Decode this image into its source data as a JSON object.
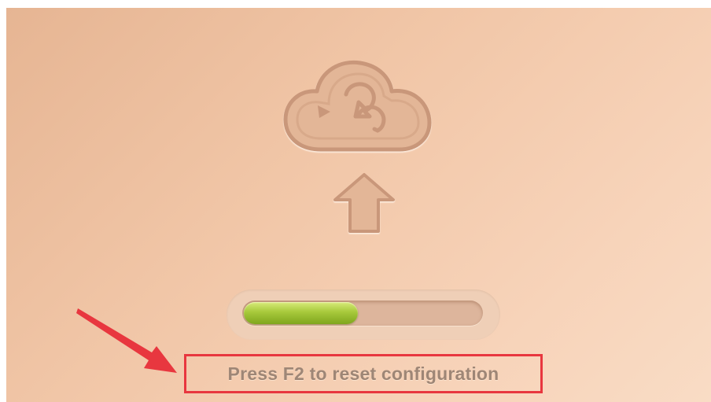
{
  "screen": {
    "icon": "cloud-upload-icon",
    "progress": {
      "fraction": 0.48,
      "fill_color": "#a7c93b"
    },
    "hint": {
      "text": "Press F2 to reset configuration",
      "box_color": "#e8373f"
    },
    "annotation": {
      "icon": "red-arrow-icon",
      "color": "#e8373f"
    }
  }
}
